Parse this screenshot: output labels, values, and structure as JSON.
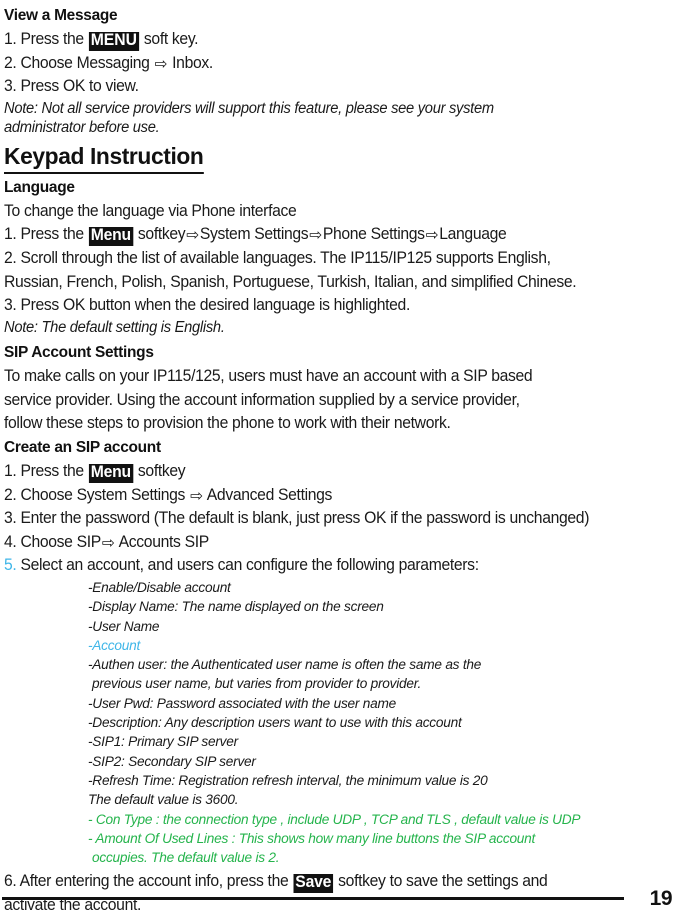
{
  "document": {
    "page_number": "19",
    "colors": {
      "text": "#1a1a1a",
      "accent_cyan": "#3fb6e8",
      "accent_green": "#25b44c",
      "key_badge_bg": "#111111",
      "key_badge_fg": "#ffffff"
    },
    "arrow_glyph": "⇨"
  },
  "view_message": {
    "heading": "View a Message",
    "step1_before": "1. Press the ",
    "step1_key": "MENU",
    "step1_after": " soft key.",
    "step2_before": "2. Choose Messaging ",
    "step2_after": " Inbox.",
    "step3": "3. Press OK to view.",
    "note_line1": " Note: Not all service providers will support this feature, please see your system",
    "note_line2": "administrator before use."
  },
  "keypad": {
    "heading": "Keypad Instruction",
    "language": {
      "heading": "Language",
      "intro": "To change the language via Phone interface",
      "step1_before": "1. Press the ",
      "step1_key": "Menu",
      "step1_seg1": " softkey",
      "step1_seg2": "System Settings",
      "step1_seg3": "Phone Settings",
      "step1_seg4": "Language",
      "step2_line1": "2. Scroll through the list of available languages. The IP115/IP125 supports English,",
      "step2_line2": "Russian, French, Polish, Spanish, Portuguese, Turkish, Italian, and simplified Chinese.",
      "step3": "3.  Press OK button  when the desired language is highlighted.",
      "note": "Note: The default setting is English."
    }
  },
  "sip_account_settings": {
    "heading": "SIP Account Settings",
    "intro_line1": "To make calls on your IP115/125, users must have an account with a SIP based",
    "intro_line2": "service provider.  Using the account information supplied by a service provider,",
    "intro_line3": "follow these steps to provision the phone to work with their network.",
    "create_heading": "Create an SIP account",
    "steps": {
      "step1_before": "1. Press the ",
      "step1_key": "Menu",
      "step1_after": " softkey",
      "step2_before": "2. Choose System Settings ",
      "step2_after": " Advanced Settings",
      "step3": "3. Enter the password (The default is blank, just press OK if the password is unchanged)",
      "step4_before": "4. Choose SIP",
      "step4_after": " Accounts SIP",
      "step5_number": "5.",
      "step5_text": " Select an account, and users can configure the following parameters:"
    },
    "parameters": [
      {
        "text": "-Enable/Disable account",
        "color": "black",
        "indent": "normal"
      },
      {
        "text": "-Display Name: The name displayed on the screen",
        "color": "black",
        "indent": "normal"
      },
      {
        "text": "-User Name",
        "color": "black",
        "indent": "normal"
      },
      {
        "text": "-Account",
        "color": "cyan",
        "indent": "normal"
      },
      {
        "text": "-Authen user: the Authenticated user name is often the same as the",
        "color": "black",
        "indent": "normal"
      },
      {
        "text": "previous user name, but varies from provider to provider.",
        "color": "black",
        "indent": "cont"
      },
      {
        "text": "-User Pwd: Password associated with the user name",
        "color": "black",
        "indent": "normal"
      },
      {
        "text": "-Description: Any description users want to use with this account",
        "color": "black",
        "indent": "normal"
      },
      {
        "text": "-SIP1: Primary SIP server",
        "color": "black",
        "indent": "normal"
      },
      {
        "text": "-SIP2: Secondary SIP server",
        "color": "black",
        "indent": "normal"
      },
      {
        "text": "-Refresh Time: Registration refresh interval, the minimum value is 20",
        "color": "black",
        "indent": "normal"
      },
      {
        "text": "The default value is 3600.",
        "color": "black",
        "indent": "normal"
      },
      {
        "text": "- Con Type : the connection type , include UDP , TCP and TLS , default value is UDP",
        "color": "green",
        "indent": "normal"
      },
      {
        "text": "-  Amount Of Used Lines : This shows how many line buttons the SIP account",
        "color": "green",
        "indent": "normal"
      },
      {
        "text": "occupies.  The default value is 2.",
        "color": "green",
        "indent": "cont"
      }
    ],
    "step6_before": "6.  After entering the account info, press the ",
    "step6_key": "Save",
    "step6_after": " softkey to save the settings and",
    "step6_line2": "activate the account."
  }
}
